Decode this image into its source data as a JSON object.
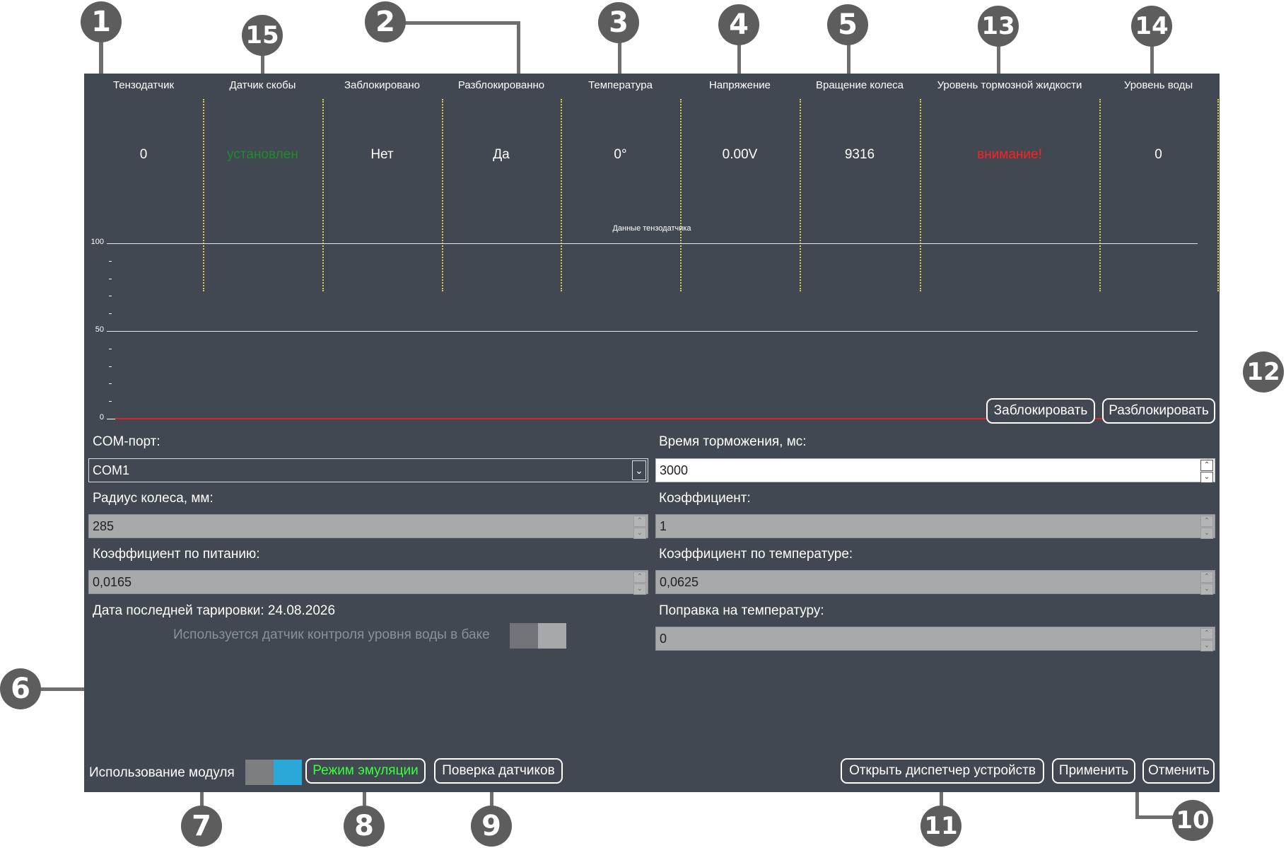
{
  "header": {
    "columns": [
      {
        "label": "Тензодатчик",
        "value": "0"
      },
      {
        "label": "Датчик скобы",
        "value": "установлен"
      },
      {
        "label": "Заблокировано",
        "value": "Нет"
      },
      {
        "label": "Разблокированно",
        "value": "Да"
      },
      {
        "label": "Температура",
        "value": "0°"
      },
      {
        "label": "Напряжение",
        "value": "0.00V"
      },
      {
        "label": "Вращение колеса",
        "value": "9316"
      },
      {
        "label": "Уровень тормозной жидкости",
        "value": "внимание!"
      },
      {
        "label": "Уровень воды",
        "value": "0"
      }
    ]
  },
  "chart_data": {
    "type": "line",
    "title": "Данные тензодатчика",
    "ylim": [
      0,
      100
    ],
    "yticks": [
      "100",
      "50",
      "0"
    ],
    "series": [
      {
        "values": [
          0,
          0
        ]
      }
    ],
    "grid": true
  },
  "chart_buttons": {
    "lock": "Заблокировать",
    "unlock": "Разблокировать"
  },
  "form": {
    "com_port": {
      "label": "COM-порт:",
      "value": "COM1"
    },
    "brake_time": {
      "label": "Время торможения, мс:",
      "value": "3000"
    },
    "wheel_radius": {
      "label": "Радиус колеса, мм:",
      "value": "285"
    },
    "coefficient": {
      "label": "Коэффициент:",
      "value": "1"
    },
    "power_coef": {
      "label": "Коэффициент по питанию:",
      "value": "0,0165"
    },
    "temp_coef": {
      "label": "Коэффициент по температуре:",
      "value": "0,0625"
    },
    "calibration_date": "Дата последней тарировки: 24.08.2026",
    "temp_correction": {
      "label": "Поправка на температуру:",
      "value": "0"
    },
    "water_sensor_label": "Используется датчик контроля уровня воды в баке"
  },
  "footer": {
    "module_usage": "Использование модуля",
    "emulation": "Режим эмуляции",
    "verify_sensors": "Поверка датчиков",
    "device_manager": "Открыть диспетчер устройств",
    "apply": "Применить",
    "cancel": "Отменить"
  },
  "callouts": [
    "1",
    "15",
    "2",
    "3",
    "4",
    "5",
    "13",
    "14",
    "12",
    "6",
    "7",
    "8",
    "9",
    "11",
    "10"
  ],
  "colors": {
    "panel": "#414852",
    "ok_green": "#1e8a2c",
    "warning_red": "#ff2020",
    "emulation_green": "#39ff3a",
    "toggle_on": "#2aa8d8",
    "chart_line": "#e0202a",
    "separator": "#d8cf4a",
    "callout": "#5d5d5d"
  }
}
